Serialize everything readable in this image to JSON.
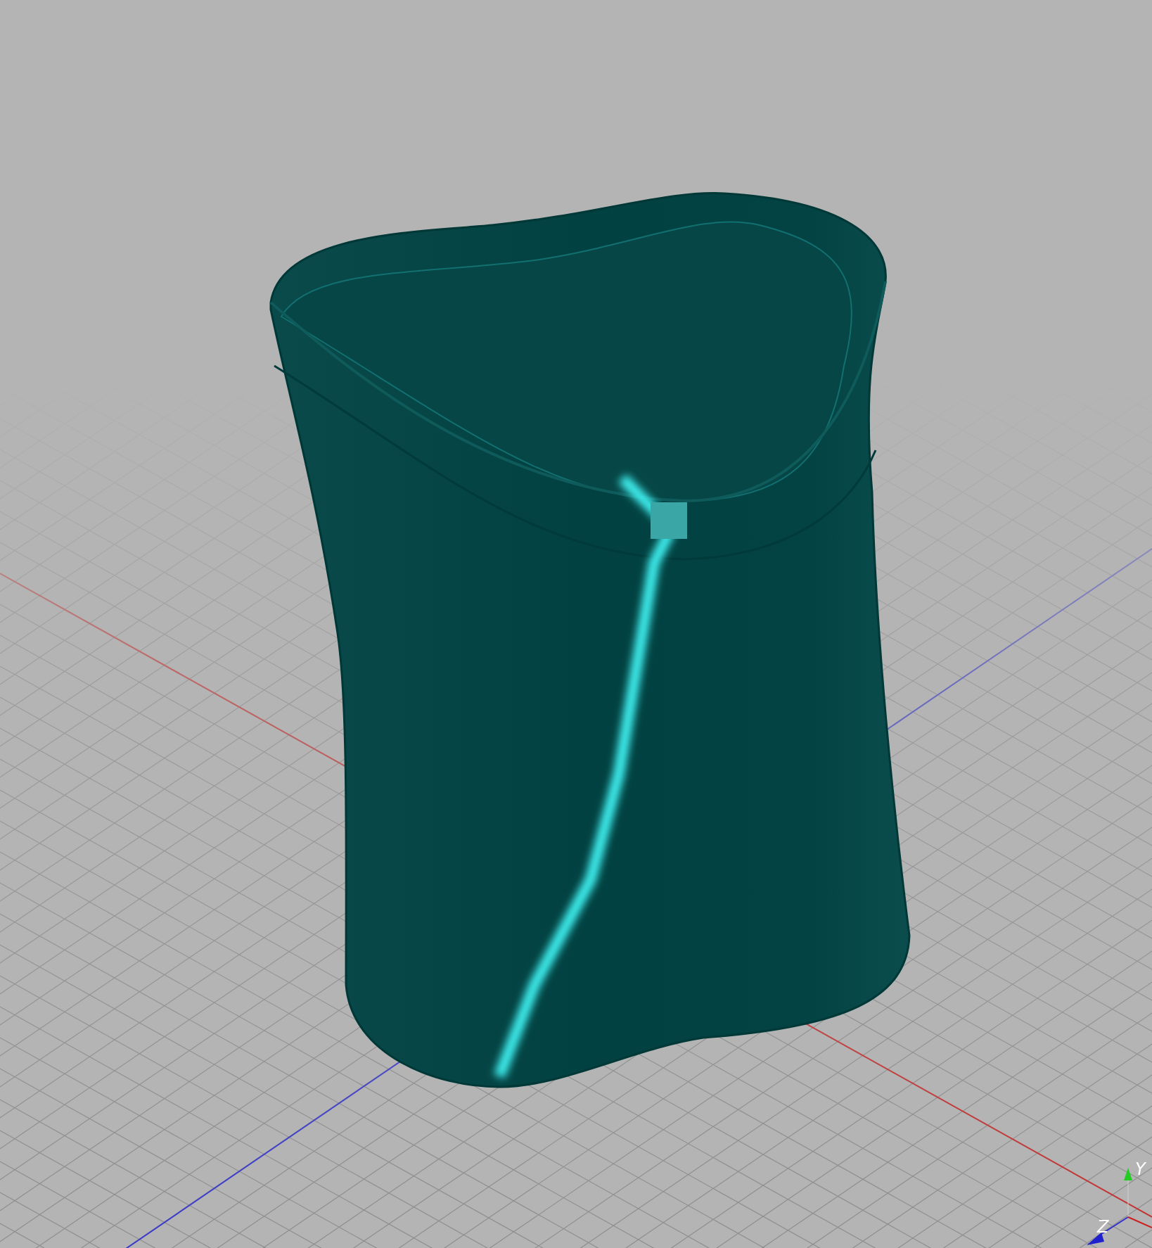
{
  "viewport": {
    "axis_gizmo": {
      "labels": [
        {
          "text": "Y",
          "kind": "y"
        },
        {
          "text": "Z",
          "kind": "z"
        }
      ]
    }
  }
}
